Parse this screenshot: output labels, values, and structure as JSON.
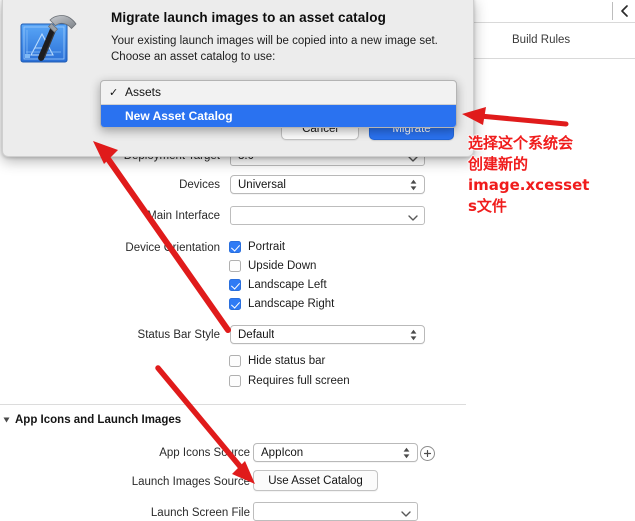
{
  "window": {
    "tab_label": "Build Rules",
    "topright_icon": "chevron-left-icon"
  },
  "sheet": {
    "app_icon": "xcode-hammer-blueprint-icon",
    "title": "Migrate launch images to an asset catalog",
    "body_line1": "Your existing launch images will be copied into a new image set.",
    "body_line2": "Choose an asset catalog to use:",
    "cancel_label": "Cancel",
    "migrate_label": "Migrate",
    "accent_color": "#2a72f0",
    "background_color": "#ececec"
  },
  "dropdown": {
    "items": [
      {
        "label": "Assets",
        "checked": true,
        "selected": false,
        "check_glyph": "✓"
      },
      {
        "label": "New Asset Catalog",
        "checked": false,
        "selected": true,
        "check_glyph": ""
      }
    ],
    "highlight_color": "#2a72f0"
  },
  "form": {
    "rows": {
      "deployment_target": {
        "label": "Deployment Target",
        "value": "8.0"
      },
      "devices": {
        "label": "Devices",
        "value": "Universal"
      },
      "main_interface": {
        "label": "Main Interface",
        "value": ""
      },
      "device_orientation_label": "Device Orientation",
      "status_bar_style": {
        "label": "Status Bar Style",
        "value": "Default"
      }
    },
    "orientation_checkboxes": [
      {
        "label": "Portrait",
        "checked": true
      },
      {
        "label": "Upside Down",
        "checked": false
      },
      {
        "label": "Landscape Left",
        "checked": true
      },
      {
        "label": "Landscape Right",
        "checked": true
      }
    ],
    "status_checkboxes": [
      {
        "label": "Hide status bar",
        "checked": false
      },
      {
        "label": "Requires full screen",
        "checked": false
      }
    ]
  },
  "app_icons_section": {
    "title": "App Icons and Launch Images",
    "app_icons_source": {
      "label": "App Icons Source",
      "value": "AppIcon",
      "add_icon": "plus-circle-icon"
    },
    "launch_images_source": {
      "label": "Launch Images Source",
      "button_label": "Use Asset Catalog"
    },
    "launch_screen_file": {
      "label": "Launch Screen File",
      "value": ""
    }
  },
  "annotations": {
    "note_line1": "选择这个系统会",
    "note_line2": "创建新的",
    "note_line3": "image.xcesset",
    "note_line4": "s文件",
    "color": "#f01c1c",
    "arrow_to_menu": "red-arrow-pointing-left-at-new-asset-catalog",
    "arrow_to_sheet": "red-arrow-pointing-up-left-at-sheet",
    "arrow_to_asset_catalog_button": "red-arrow-pointing-down-right-at-use-asset-catalog"
  }
}
